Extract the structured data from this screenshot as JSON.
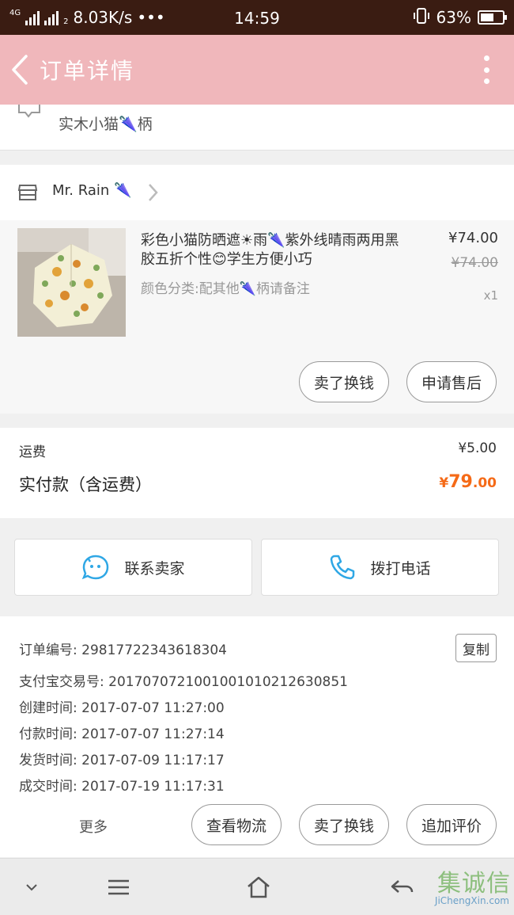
{
  "status_bar": {
    "network": "4G",
    "sim": "2",
    "speed": "8.03K/s",
    "dots": "•••",
    "time": "14:59",
    "battery": "63%",
    "battery_level": 0.63
  },
  "header": {
    "title": "订单详情",
    "background": "#f0b7bb"
  },
  "remark": {
    "text": "实木小猫🌂柄"
  },
  "shop": {
    "name": "Mr. Rain 🌂"
  },
  "item": {
    "title": "彩色小猫防晒遮☀雨🌂紫外线晴雨两用黑胶五折个性😊学生方便小巧",
    "sku": "颜色分类:配其他🌂柄请备注",
    "price": "¥74.00",
    "original_price": "¥74.00",
    "quantity": "x1",
    "buttons": {
      "resell": "卖了换钱",
      "after_sale": "申请售后"
    }
  },
  "fees": {
    "shipping_label": "运费",
    "shipping_value": "¥5.00",
    "paid_label": "实付款（含运费）",
    "paid_currency": "¥",
    "paid_integer": "79",
    "paid_decimal": ".00",
    "accent": "#f56a17"
  },
  "contact": {
    "seller_label": "联系卖家",
    "call_label": "拨打电话"
  },
  "order_info": {
    "order_no": "订单编号: 2981772234361830​4",
    "copy_label": "复制",
    "alipay_no": "支付宝交易号: 2017070721001001010212630851",
    "created": "创建时间: 2017-07-07 11:27:00",
    "paid": "付款时间: 2017-07-07 11:27:14",
    "shipped": "发货时间: 2017-07-09 11:17:17",
    "completed": "成交时间: 2017-07-19 11:17:31",
    "more_label": "更多",
    "buttons": {
      "logistics": "查看物流",
      "resell": "卖了换钱",
      "review": "追加评价"
    }
  },
  "watermark": {
    "glyphs": "集诚信",
    "url": "JiChengXin.com"
  }
}
